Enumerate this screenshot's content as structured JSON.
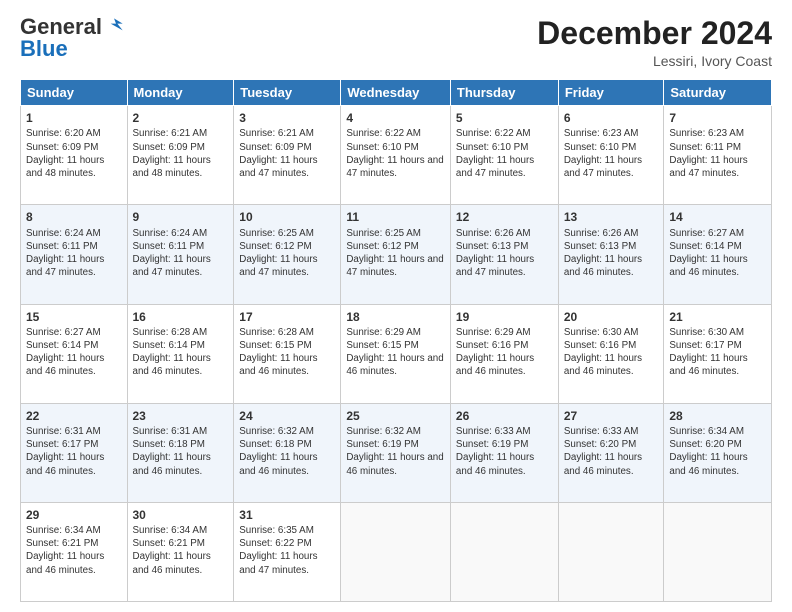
{
  "logo": {
    "general": "General",
    "blue": "Blue"
  },
  "header": {
    "month": "December 2024",
    "location": "Lessiri, Ivory Coast"
  },
  "days_of_week": [
    "Sunday",
    "Monday",
    "Tuesday",
    "Wednesday",
    "Thursday",
    "Friday",
    "Saturday"
  ],
  "weeks": [
    [
      {
        "day": "1",
        "info": "Sunrise: 6:20 AM\nSunset: 6:09 PM\nDaylight: 11 hours and 48 minutes."
      },
      {
        "day": "2",
        "info": "Sunrise: 6:21 AM\nSunset: 6:09 PM\nDaylight: 11 hours and 48 minutes."
      },
      {
        "day": "3",
        "info": "Sunrise: 6:21 AM\nSunset: 6:09 PM\nDaylight: 11 hours and 47 minutes."
      },
      {
        "day": "4",
        "info": "Sunrise: 6:22 AM\nSunset: 6:10 PM\nDaylight: 11 hours and 47 minutes."
      },
      {
        "day": "5",
        "info": "Sunrise: 6:22 AM\nSunset: 6:10 PM\nDaylight: 11 hours and 47 minutes."
      },
      {
        "day": "6",
        "info": "Sunrise: 6:23 AM\nSunset: 6:10 PM\nDaylight: 11 hours and 47 minutes."
      },
      {
        "day": "7",
        "info": "Sunrise: 6:23 AM\nSunset: 6:11 PM\nDaylight: 11 hours and 47 minutes."
      }
    ],
    [
      {
        "day": "8",
        "info": "Sunrise: 6:24 AM\nSunset: 6:11 PM\nDaylight: 11 hours and 47 minutes."
      },
      {
        "day": "9",
        "info": "Sunrise: 6:24 AM\nSunset: 6:11 PM\nDaylight: 11 hours and 47 minutes."
      },
      {
        "day": "10",
        "info": "Sunrise: 6:25 AM\nSunset: 6:12 PM\nDaylight: 11 hours and 47 minutes."
      },
      {
        "day": "11",
        "info": "Sunrise: 6:25 AM\nSunset: 6:12 PM\nDaylight: 11 hours and 47 minutes."
      },
      {
        "day": "12",
        "info": "Sunrise: 6:26 AM\nSunset: 6:13 PM\nDaylight: 11 hours and 47 minutes."
      },
      {
        "day": "13",
        "info": "Sunrise: 6:26 AM\nSunset: 6:13 PM\nDaylight: 11 hours and 46 minutes."
      },
      {
        "day": "14",
        "info": "Sunrise: 6:27 AM\nSunset: 6:14 PM\nDaylight: 11 hours and 46 minutes."
      }
    ],
    [
      {
        "day": "15",
        "info": "Sunrise: 6:27 AM\nSunset: 6:14 PM\nDaylight: 11 hours and 46 minutes."
      },
      {
        "day": "16",
        "info": "Sunrise: 6:28 AM\nSunset: 6:14 PM\nDaylight: 11 hours and 46 minutes."
      },
      {
        "day": "17",
        "info": "Sunrise: 6:28 AM\nSunset: 6:15 PM\nDaylight: 11 hours and 46 minutes."
      },
      {
        "day": "18",
        "info": "Sunrise: 6:29 AM\nSunset: 6:15 PM\nDaylight: 11 hours and 46 minutes."
      },
      {
        "day": "19",
        "info": "Sunrise: 6:29 AM\nSunset: 6:16 PM\nDaylight: 11 hours and 46 minutes."
      },
      {
        "day": "20",
        "info": "Sunrise: 6:30 AM\nSunset: 6:16 PM\nDaylight: 11 hours and 46 minutes."
      },
      {
        "day": "21",
        "info": "Sunrise: 6:30 AM\nSunset: 6:17 PM\nDaylight: 11 hours and 46 minutes."
      }
    ],
    [
      {
        "day": "22",
        "info": "Sunrise: 6:31 AM\nSunset: 6:17 PM\nDaylight: 11 hours and 46 minutes."
      },
      {
        "day": "23",
        "info": "Sunrise: 6:31 AM\nSunset: 6:18 PM\nDaylight: 11 hours and 46 minutes."
      },
      {
        "day": "24",
        "info": "Sunrise: 6:32 AM\nSunset: 6:18 PM\nDaylight: 11 hours and 46 minutes."
      },
      {
        "day": "25",
        "info": "Sunrise: 6:32 AM\nSunset: 6:19 PM\nDaylight: 11 hours and 46 minutes."
      },
      {
        "day": "26",
        "info": "Sunrise: 6:33 AM\nSunset: 6:19 PM\nDaylight: 11 hours and 46 minutes."
      },
      {
        "day": "27",
        "info": "Sunrise: 6:33 AM\nSunset: 6:20 PM\nDaylight: 11 hours and 46 minutes."
      },
      {
        "day": "28",
        "info": "Sunrise: 6:34 AM\nSunset: 6:20 PM\nDaylight: 11 hours and 46 minutes."
      }
    ],
    [
      {
        "day": "29",
        "info": "Sunrise: 6:34 AM\nSunset: 6:21 PM\nDaylight: 11 hours and 46 minutes."
      },
      {
        "day": "30",
        "info": "Sunrise: 6:34 AM\nSunset: 6:21 PM\nDaylight: 11 hours and 46 minutes."
      },
      {
        "day": "31",
        "info": "Sunrise: 6:35 AM\nSunset: 6:22 PM\nDaylight: 11 hours and 47 minutes."
      },
      null,
      null,
      null,
      null
    ]
  ]
}
